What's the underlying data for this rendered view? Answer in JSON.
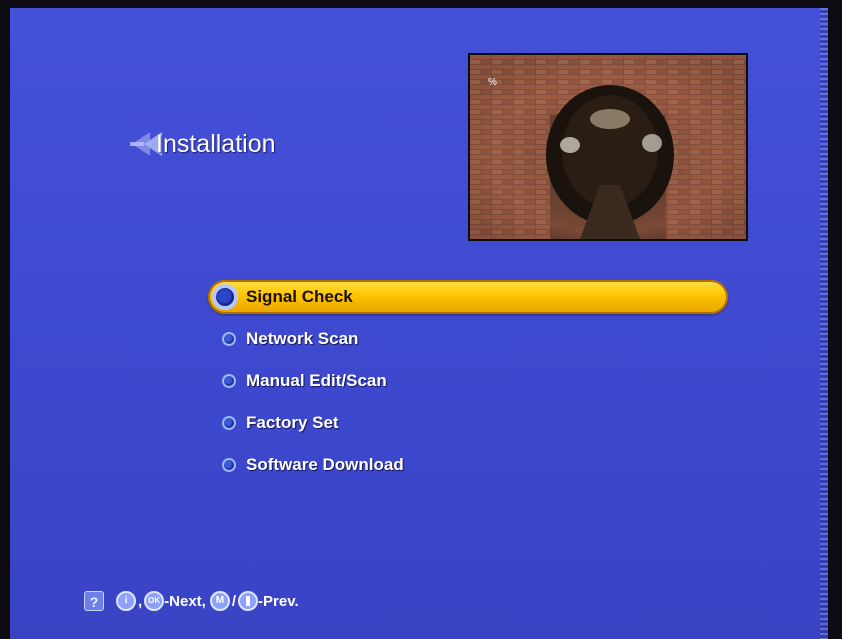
{
  "header": {
    "title": "Installation",
    "icon": "back-arrows-icon"
  },
  "preview": {
    "icon": "live-tv-preview"
  },
  "menu": {
    "items": [
      {
        "label": "Signal Check",
        "selected": true
      },
      {
        "label": "Network Scan",
        "selected": false
      },
      {
        "label": "Manual Edit/Scan",
        "selected": false
      },
      {
        "label": "Factory Set",
        "selected": false
      },
      {
        "label": "Software Download",
        "selected": false
      }
    ]
  },
  "footer": {
    "help_icon": "?",
    "info_key": "i",
    "comma": ",",
    "ok_key": "OK",
    "next_label": "-Next,",
    "menu_key": "M",
    "slash": "/",
    "back_key": "",
    "prev_label": "-Prev."
  },
  "colors": {
    "background": "#4550d8",
    "highlight": "#ffc400",
    "text": "#ffffff"
  }
}
